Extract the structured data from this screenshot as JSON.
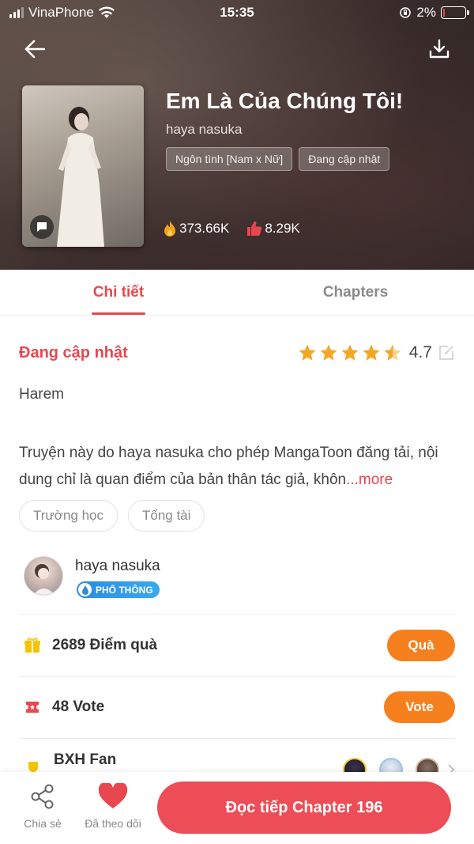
{
  "status_bar": {
    "carrier": "VinaPhone",
    "time": "15:35",
    "battery": "2%"
  },
  "book": {
    "title": "Em Là Của Chúng Tôi!",
    "author": "haya nasuka",
    "tags": [
      "Ngôn tình [Nam x Nữ]",
      "Đang cập nhật"
    ],
    "views": "373.66K",
    "likes": "8.29K"
  },
  "tabs": [
    {
      "label": "Chi tiết",
      "active": true
    },
    {
      "label": "Chapters",
      "active": false
    }
  ],
  "detail": {
    "status": "Đang cập nhật",
    "rating": "4.7",
    "stars_filled": 4.5,
    "genre": "Harem",
    "description": "Truyện này do haya nasuka cho phép MangaToon đăng tải, nội dung chỉ là quan điểm của bản thân tác giả, khôn",
    "more": "...more",
    "pills": [
      "Trường học",
      "Tổng tài"
    ]
  },
  "author_card": {
    "name": "haya nasuka",
    "level": "PHỔ THÔNG"
  },
  "gifts": {
    "label": "2689 Điểm quà",
    "button": "Quà"
  },
  "votes": {
    "label": "48 Vote",
    "button": "Vote"
  },
  "fans": {
    "label": "BXH Fan"
  },
  "bottom_bar": {
    "share_label": "Chia sẻ",
    "follow_label": "Đã theo dõi",
    "read_button": "Đọc tiếp Chapter 196"
  },
  "colors": {
    "accent": "#e8474f",
    "orange": "#f7801e",
    "read_button": "#ed4d56"
  }
}
